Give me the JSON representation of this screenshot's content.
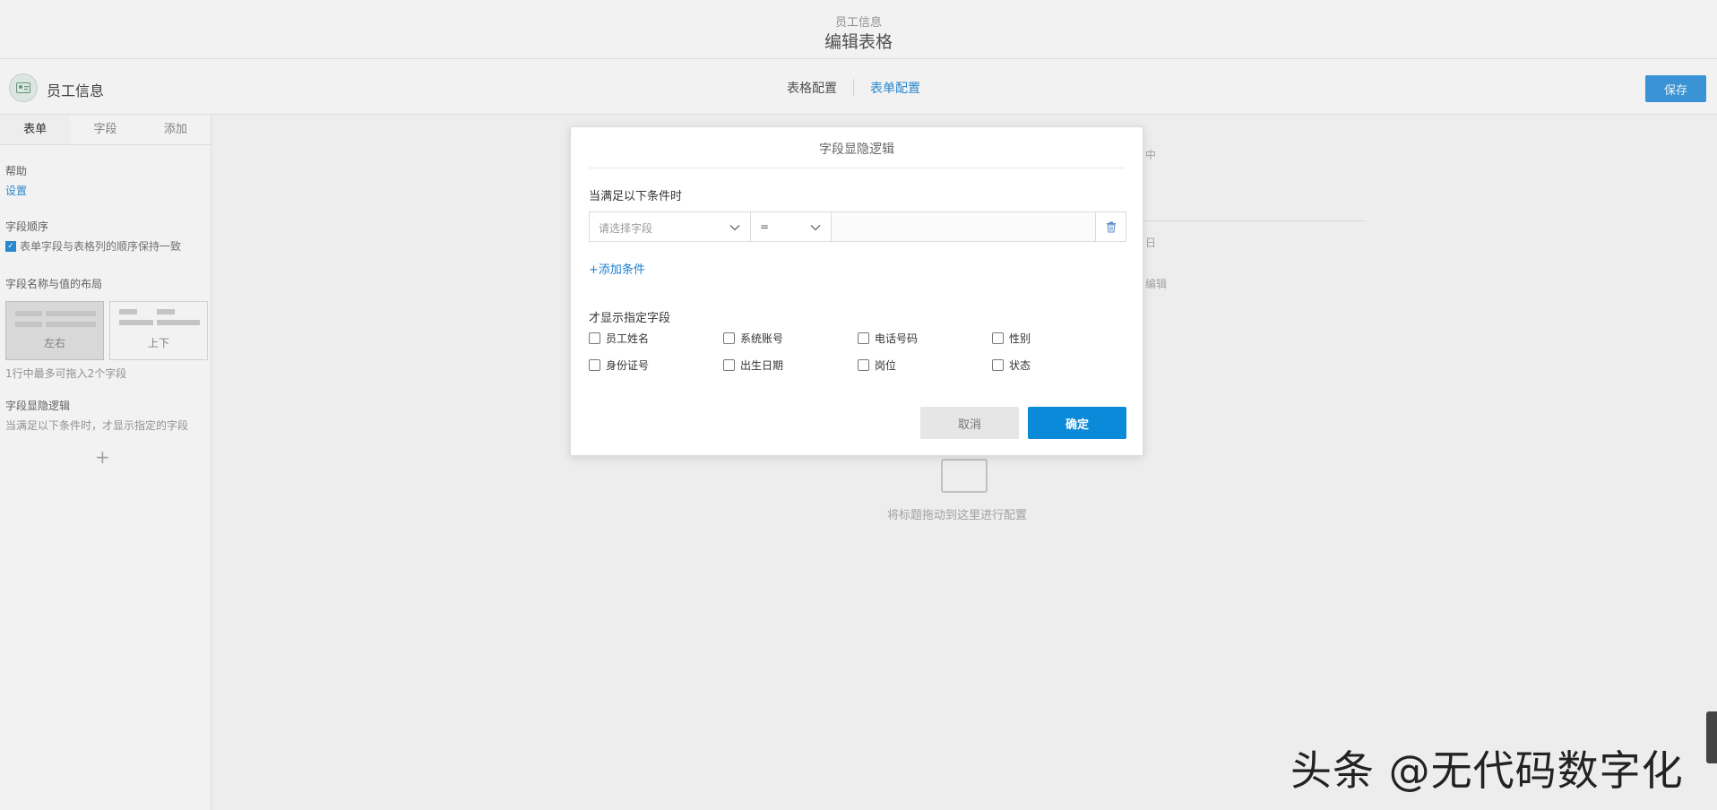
{
  "header": {
    "subtitle": "员工信息",
    "title": "编辑表格"
  },
  "app": {
    "icon": "id-card-icon",
    "name": "员工信息",
    "tabs": [
      {
        "label": "表格配置"
      },
      {
        "label": "表单配置"
      }
    ],
    "save_label": "保存"
  },
  "left_panel": {
    "tabs": [
      {
        "label": "表单"
      },
      {
        "label": "字段"
      },
      {
        "label": "添加"
      }
    ],
    "help_label": "帮助",
    "settings_link": "设置",
    "order_title": "字段顺序",
    "order_checkbox": "表单字段与表格列的顺序保持一致",
    "layout_title": "字段名称与值的布局",
    "layout_options": [
      {
        "label": "左右"
      },
      {
        "label": "上下"
      }
    ],
    "layout_hint": "1行中最多可拖入2个字段",
    "logic_title": "字段显隐逻辑",
    "logic_desc": "当满足以下条件时，才显示指定的字段",
    "add_symbol": "+"
  },
  "canvas": {
    "frag1": "中",
    "frag2": "日",
    "frag3": "编辑",
    "empty_text": "将标题拖动到这里进行配置"
  },
  "modal": {
    "title": "字段显隐逻辑",
    "when_label": "当满足以下条件时",
    "condition": {
      "field_placeholder": "请选择字段",
      "operator": "=",
      "value": ""
    },
    "add_condition_label": "+添加条件",
    "show_label": "才显示指定字段",
    "fields": [
      {
        "label": "员工姓名"
      },
      {
        "label": "系统账号"
      },
      {
        "label": "电话号码"
      },
      {
        "label": "性别"
      },
      {
        "label": "身份证号"
      },
      {
        "label": "出生日期"
      },
      {
        "label": "岗位"
      },
      {
        "label": "状态"
      }
    ],
    "cancel_label": "取消",
    "ok_label": "确定"
  },
  "watermark": "头条 @无代码数字化",
  "colors": {
    "primary": "#0a8ad8",
    "link": "#1a7fd0",
    "cancel_bg": "#e6e6e6"
  }
}
